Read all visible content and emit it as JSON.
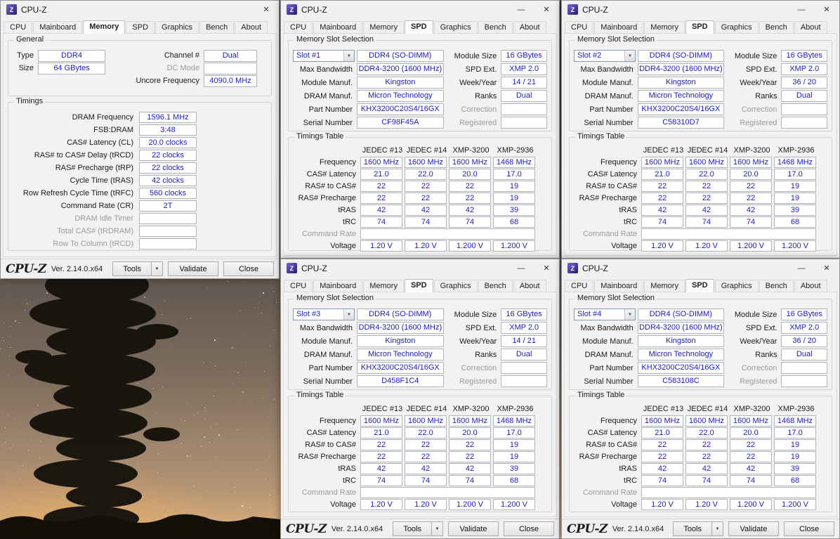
{
  "app": {
    "title": "CPU-Z",
    "tabs": [
      "CPU",
      "Mainboard",
      "Memory",
      "SPD",
      "Graphics",
      "Bench",
      "About"
    ],
    "logo": "CPU-Z",
    "version": "Ver. 2.14.0.x64",
    "buttons": {
      "tools": "Tools",
      "validate": "Validate",
      "close": "Close"
    },
    "icons": {
      "minimize": "—",
      "close": "✕",
      "dropdown": "▼"
    }
  },
  "memory_window": {
    "general": {
      "title": "General",
      "type_label": "Type",
      "type_value": "DDR4",
      "size_label": "Size",
      "size_value": "64 GBytes",
      "channel_label": "Channel #",
      "channel_value": "Dual",
      "dc_mode_label": "DC Mode",
      "dc_mode_value": "",
      "uncore_label": "Uncore Frequency",
      "uncore_value": "4090.0 MHz"
    },
    "timings": {
      "title": "Timings",
      "rows": [
        {
          "label": "DRAM Frequency",
          "value": "1596.1 MHz"
        },
        {
          "label": "FSB:DRAM",
          "value": "3:48"
        },
        {
          "label": "CAS# Latency (CL)",
          "value": "20.0 clocks"
        },
        {
          "label": "RAS# to CAS# Delay (tRCD)",
          "value": "22 clocks"
        },
        {
          "label": "RAS# Precharge (tRP)",
          "value": "22 clocks"
        },
        {
          "label": "Cycle Time (tRAS)",
          "value": "42 clocks"
        },
        {
          "label": "Row Refresh Cycle Time (tRFC)",
          "value": "560 clocks"
        },
        {
          "label": "Command Rate (CR)",
          "value": "2T"
        },
        {
          "label": "DRAM Idle Timer",
          "value": ""
        },
        {
          "label": "Total CAS# (tRDRAM)",
          "value": ""
        },
        {
          "label": "Row To Column (tRCD)",
          "value": ""
        }
      ]
    }
  },
  "spd_labels": {
    "group1_title": "Memory Slot Selection",
    "max_bandwidth": "Max Bandwidth",
    "module_manuf": "Module Manuf.",
    "dram_manuf": "DRAM Manuf.",
    "part_number": "Part Number",
    "serial_number": "Serial Number",
    "module_size": "Module Size",
    "spd_ext": "SPD Ext.",
    "week_year": "Week/Year",
    "ranks": "Ranks",
    "correction": "Correction",
    "registered": "Registered",
    "group2_title": "Timings Table"
  },
  "timings_table": {
    "columns": [
      "JEDEC #13",
      "JEDEC #14",
      "XMP-3200",
      "XMP-2936"
    ],
    "rows": [
      {
        "label": "Frequency",
        "values": [
          "1600 MHz",
          "1600 MHz",
          "1600 MHz",
          "1468 MHz"
        ]
      },
      {
        "label": "CAS# Latency",
        "values": [
          "21.0",
          "22.0",
          "20.0",
          "17.0"
        ]
      },
      {
        "label": "RAS# to CAS#",
        "values": [
          "22",
          "22",
          "22",
          "19"
        ]
      },
      {
        "label": "RAS# Precharge",
        "values": [
          "22",
          "22",
          "22",
          "19"
        ]
      },
      {
        "label": "tRAS",
        "values": [
          "42",
          "42",
          "42",
          "39"
        ]
      },
      {
        "label": "tRC",
        "values": [
          "74",
          "74",
          "74",
          "68"
        ]
      },
      {
        "label": "Command Rate",
        "values": [
          "",
          "",
          "",
          ""
        ]
      },
      {
        "label": "Voltage",
        "values": [
          "1.20 V",
          "1.20 V",
          "1.200 V",
          "1.200 V"
        ]
      }
    ]
  },
  "spd_windows": [
    {
      "slot": "Slot #1",
      "module_type": "DDR4 (SO-DIMM)",
      "max_bandwidth": "DDR4-3200 (1600 MHz)",
      "module_manuf": "Kingston",
      "dram_manuf": "Micron Technology",
      "part_number": "KHX3200C20S4/16GX",
      "serial_number": "CF98F45A",
      "module_size": "16 GBytes",
      "spd_ext": "XMP 2.0",
      "week_year": "14 / 21",
      "ranks": "Dual",
      "correction": "",
      "registered": ""
    },
    {
      "slot": "Slot #2",
      "module_type": "DDR4 (SO-DIMM)",
      "max_bandwidth": "DDR4-3200 (1600 MHz)",
      "module_manuf": "Kingston",
      "dram_manuf": "Micron Technology",
      "part_number": "KHX3200C20S4/16GX",
      "serial_number": "C58310D7",
      "module_size": "16 GBytes",
      "spd_ext": "XMP 2.0",
      "week_year": "36 / 20",
      "ranks": "Dual",
      "correction": "",
      "registered": ""
    },
    {
      "slot": "Slot #3",
      "module_type": "DDR4 (SO-DIMM)",
      "max_bandwidth": "DDR4-3200 (1600 MHz)",
      "module_manuf": "Kingston",
      "dram_manuf": "Micron Technology",
      "part_number": "KHX3200C20S4/16GX",
      "serial_number": "D458F1C4",
      "module_size": "16 GBytes",
      "spd_ext": "XMP 2.0",
      "week_year": "14 / 21",
      "ranks": "Dual",
      "correction": "",
      "registered": ""
    },
    {
      "slot": "Slot #4",
      "module_type": "DDR4 (SO-DIMM)",
      "max_bandwidth": "DDR4-3200 (1600 MHz)",
      "module_manuf": "Kingston",
      "dram_manuf": "Micron Technology",
      "part_number": "KHX3200C20S4/16GX",
      "serial_number": "C583108C",
      "module_size": "16 GBytes",
      "spd_ext": "XMP 2.0",
      "week_year": "36 / 20",
      "ranks": "Dual",
      "correction": "",
      "registered": ""
    }
  ]
}
